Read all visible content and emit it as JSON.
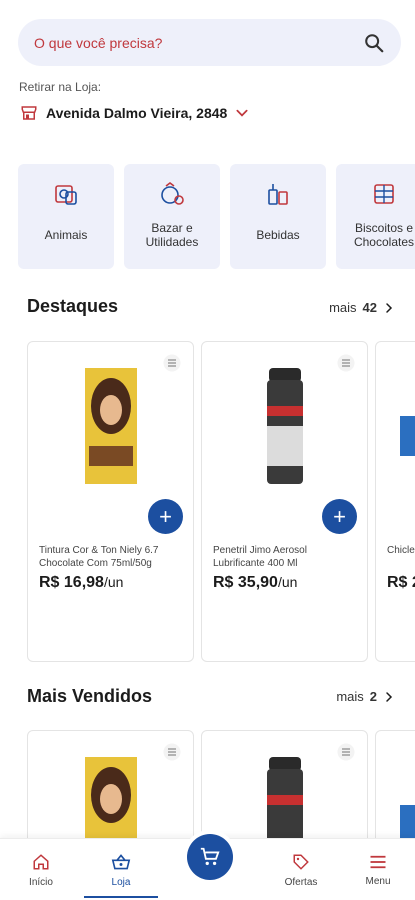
{
  "search": {
    "placeholder": "O que você precisa?"
  },
  "pickup": {
    "label": "Retirar na Loja:",
    "store": "Avenida Dalmo Vieira, 2848"
  },
  "categories": [
    {
      "label": "Animais",
      "icon": "pet-icon"
    },
    {
      "label": "Bazar e Utilidades",
      "icon": "kitchenware-icon"
    },
    {
      "label": "Bebidas",
      "icon": "drinks-icon"
    },
    {
      "label": "Biscoitos e Chocolates",
      "icon": "cookies-icon"
    }
  ],
  "destaques": {
    "title": "Destaques",
    "more_label": "mais",
    "more_count": "42",
    "products": [
      {
        "name": "Tintura Cor & Ton Niely 6.7 Chocolate Com 75ml/50g",
        "price": "R$ 16,98",
        "unit": "/un"
      },
      {
        "name": "Penetril Jimo Aerosol Lubrificante 400 Ml",
        "price": "R$ 35,90",
        "unit": "/un"
      },
      {
        "name": "Chicle Cool W",
        "price": "R$ 2",
        "unit": ""
      }
    ]
  },
  "mais_vendidos": {
    "title": "Mais Vendidos",
    "more_label": "mais",
    "more_count": "2"
  },
  "nav": {
    "inicio": "Início",
    "loja": "Loja",
    "ofertas": "Ofertas",
    "menu": "Menu"
  },
  "colors": {
    "brand_blue": "#1c4fa0",
    "brand_red": "#c0383d",
    "surface": "#eef0fa"
  }
}
